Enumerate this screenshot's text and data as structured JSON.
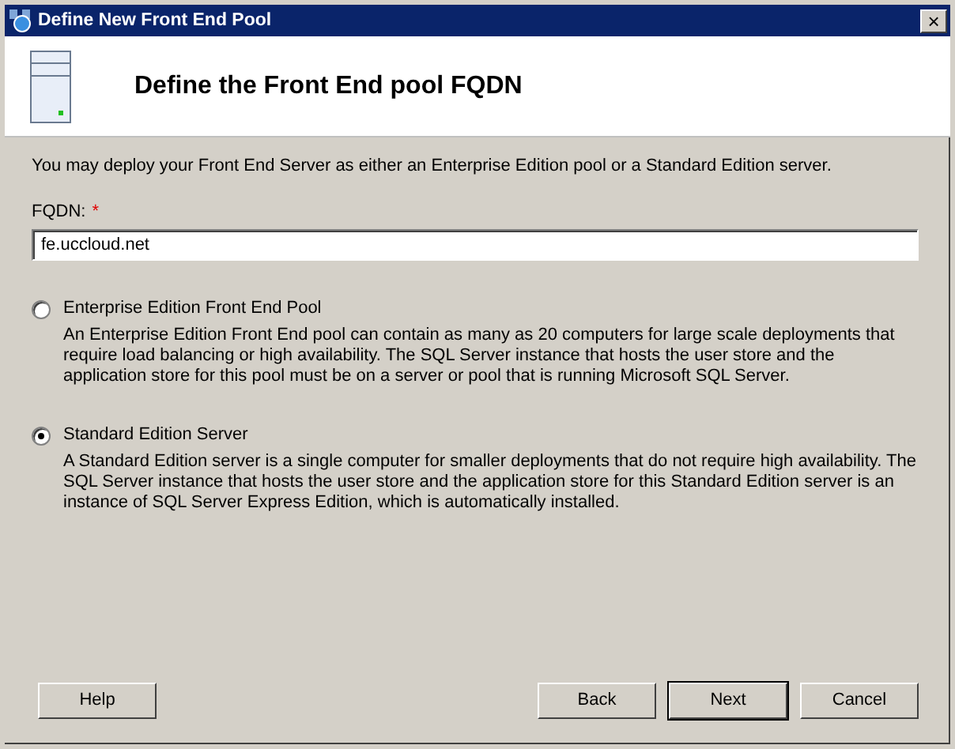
{
  "window": {
    "title": "Define New Front End Pool",
    "close": "×"
  },
  "header": {
    "title": "Define the Front End pool FQDN"
  },
  "intro": "You may deploy your Front End Server as either an Enterprise Edition pool or a Standard Edition server.",
  "fqdn": {
    "label": "FQDN:",
    "required": "*",
    "value": "fe.uccloud.net"
  },
  "options": [
    {
      "label": "Enterprise Edition Front End Pool",
      "selected": false,
      "description": "An Enterprise Edition Front End pool can contain as many as 20 computers for large scale deployments that require load balancing or high availability. The SQL Server instance that hosts the user store and the application store for this pool must be on a server or pool that is running Microsoft SQL Server."
    },
    {
      "label": "Standard Edition Server",
      "selected": true,
      "description": "A Standard Edition server is a single computer for smaller deployments that do not require high availability. The SQL Server instance that hosts the user store and the application store for this Standard Edition server is an instance of SQL Server Express Edition, which is automatically installed."
    }
  ],
  "buttons": [
    {
      "label": "Help",
      "kind": "left",
      "default": false
    },
    {
      "label": "Back",
      "kind": "right",
      "default": false
    },
    {
      "label": "Next",
      "kind": "right",
      "default": true
    },
    {
      "label": "Cancel",
      "kind": "right",
      "default": false
    }
  ]
}
